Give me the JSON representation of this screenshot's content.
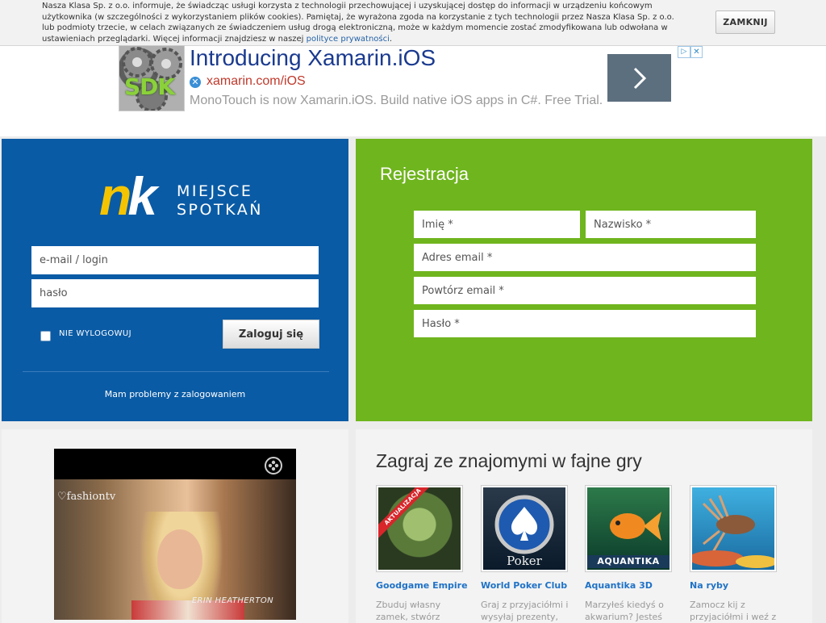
{
  "cookie": {
    "text": "Nasza Klasa Sp. z o.o. informuje, że świadcząc usługi korzysta z technologii przechowującej i uzyskującej dostęp do informacji w urządzeniu końcowym użytkownika (w szczególności z wykorzystaniem plików cookies). Pamiętaj, że wyrażona zgoda na korzystanie z tych technologii przez Nasza Klasa Sp. z o.o. lub podmioty trzecie, w celach związanych ze świadczeniem usług drogą elektroniczną, może w każdym momencie zostać zmodyfikowana lub odwołana w ustawieniach przeglądarki. Więcej informacji znajdziesz w naszej",
    "link": "polityce prywatności",
    "link_suffix": ".",
    "close_label": "ZAMKNIJ"
  },
  "ad": {
    "image_text": "SDK",
    "title": "Introducing Xamarin.iOS",
    "url": "xamarin.com/iOS",
    "description": "MonoTouch is now Xamarin.iOS. Build native iOS apps in C#. Free Trial.",
    "choices_icon": "ad-choices-icon",
    "close_icon": "ad-close-icon"
  },
  "login": {
    "logo_n": "n",
    "logo_k": "k",
    "tagline_1": "MIEJSCE",
    "tagline_2": "SPOTKAŃ",
    "email_placeholder": "e-mail / login",
    "password_placeholder": "hasło",
    "remember_label": "NIE WYLOGOWUJ",
    "submit_label": "Zaloguj się",
    "problem_link": "Mam problemy z zalogowaniem"
  },
  "register": {
    "title": "Rejestracja",
    "first_name": "Imię *",
    "last_name": "Nazwisko *",
    "email": "Adres email *",
    "email_repeat": "Powtórz email *",
    "password": "Hasło *"
  },
  "video": {
    "brand": "fashiontv",
    "caption": "ERIN HEATHERTON"
  },
  "games": {
    "title": "Zagraj ze znajomymi w fajne gry",
    "items": [
      {
        "name": "Goodgame Empire",
        "desc": "Zbuduj własny zamek, stwórz",
        "badge": "AKTUALIZACJA"
      },
      {
        "name": "World Poker Club",
        "desc": "Graj z przyjaciółmi i wysyłaj prezenty,",
        "pic_text": "Poker"
      },
      {
        "name": "Aquantika 3D",
        "desc": "Marzyłeś kiedyś o akwarium? Jesteś",
        "pic_text": "AQUANTIKA"
      },
      {
        "name": "Na ryby",
        "desc": "Zamocz kij z przyjaciółmi i weź z"
      }
    ]
  },
  "colors": {
    "login_bg": "#0a5ba5",
    "register_bg": "#6fb51e",
    "logo_yellow": "#f5c400",
    "link_blue": "#1f72c7"
  }
}
